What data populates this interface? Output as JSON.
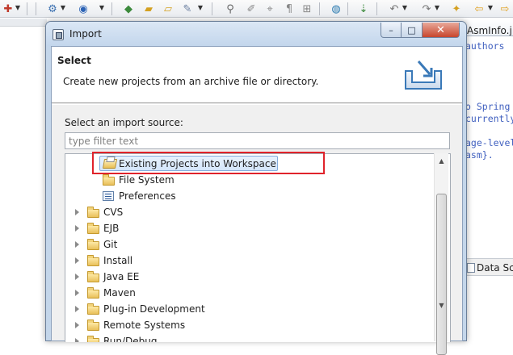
{
  "ide": {
    "editor_tab_label": "AsmInfo.j",
    "code_lines": [
      "authors",
      "o Spring",
      "currently",
      "age-level",
      "asm}."
    ],
    "bottom_tab_label": "Data Sc"
  },
  "dialog": {
    "title": "Import",
    "window_controls": {
      "minimize": "–",
      "maximize": "□",
      "close": "✕"
    },
    "header_title": "Select",
    "header_description": "Create new projects from an archive file or directory.",
    "source_label": "Select an import source:",
    "filter_placeholder": "type filter text",
    "filter_value": "",
    "tree": {
      "selected_item": "Existing Projects into Workspace",
      "children": [
        {
          "label": "Existing Projects into Workspace",
          "icon": "existing-projects-icon",
          "selected": true
        },
        {
          "label": "File System",
          "icon": "folder-icon"
        },
        {
          "label": "Preferences",
          "icon": "preferences-icon"
        }
      ],
      "categories": [
        "CVS",
        "EJB",
        "Git",
        "Install",
        "Java EE",
        "Maven",
        "Plug-in Development",
        "Remote Systems",
        "Run/Debug"
      ]
    }
  },
  "colors": {
    "highlight_border": "#e0232b",
    "selection_fill": "#d4e6fb",
    "dialog_frame": "#c4d6ea",
    "close_button": "#c7452d"
  }
}
